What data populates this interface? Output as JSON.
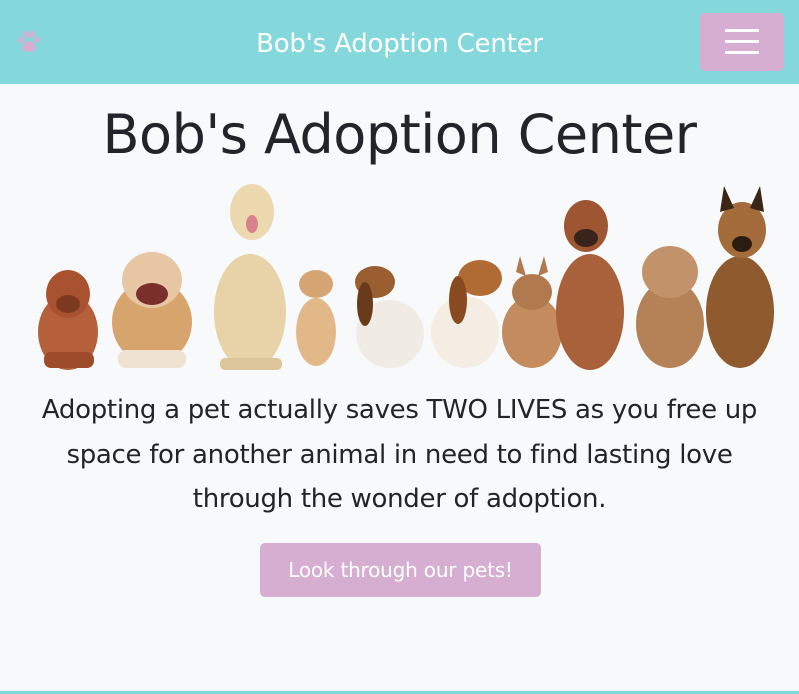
{
  "navbar": {
    "brand_icon": "paw-icon",
    "title": "Bob's Adoption Center",
    "toggler_icon": "hamburger-menu-icon",
    "background_color": "#84d8dc",
    "accent_color": "#d6aed2"
  },
  "hero": {
    "title": "Bob's Adoption Center",
    "image": "row-of-dogs",
    "tagline": "Adopting a pet actually saves TWO LIVES as you free up space for another animal in need to find lasting love through the wonder of adoption.",
    "cta_label": "Look through our pets!"
  }
}
